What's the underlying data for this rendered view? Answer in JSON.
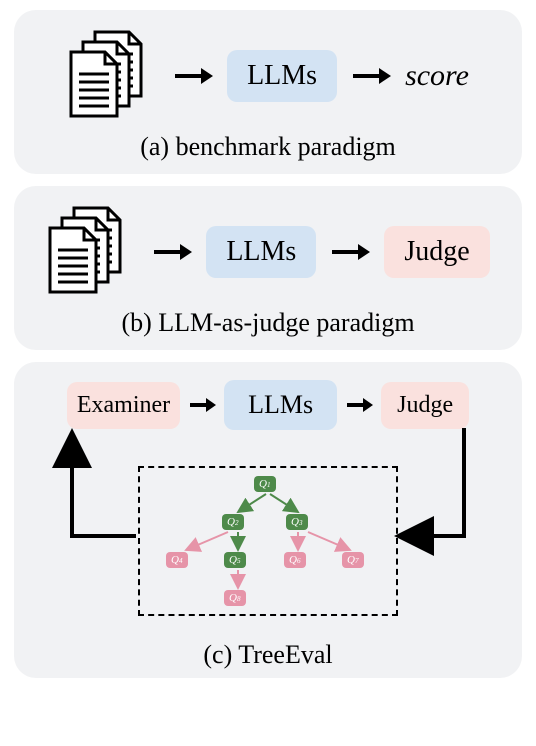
{
  "panels": {
    "a": {
      "caption": "(a) benchmark paradigm",
      "llm": "LLMs",
      "output": "score"
    },
    "b": {
      "caption": "(b) LLM-as-judge paradigm",
      "llm": "LLMs",
      "judge": "Judge"
    },
    "c": {
      "caption": "(c) TreeEval",
      "examiner": "Examiner",
      "llm": "LLMs",
      "judge": "Judge",
      "tree_nodes": [
        {
          "id": "Q1",
          "label": "Q₁",
          "role": "green"
        },
        {
          "id": "Q2",
          "label": "Q₂",
          "role": "green"
        },
        {
          "id": "Q3",
          "label": "Q₃",
          "role": "green"
        },
        {
          "id": "Q4",
          "label": "Q₄",
          "role": "pink"
        },
        {
          "id": "Q5",
          "label": "Q₅",
          "role": "green"
        },
        {
          "id": "Q6",
          "label": "Q₆",
          "role": "pink"
        },
        {
          "id": "Q7",
          "label": "Q₇",
          "role": "pink"
        },
        {
          "id": "Q8",
          "label": "Q₈",
          "role": "pink"
        }
      ]
    }
  },
  "colors": {
    "panel_bg": "#f1f2f4",
    "blue": "#d3e3f3",
    "pink": "#fae1de",
    "node_green": "#4e8a4a",
    "node_pink": "#e694a8"
  },
  "chart_data": {
    "type": "tree",
    "title": "TreeEval question tree",
    "nodes": [
      "Q1",
      "Q2",
      "Q3",
      "Q4",
      "Q5",
      "Q6",
      "Q7",
      "Q8"
    ],
    "edges": [
      [
        "Q1",
        "Q2"
      ],
      [
        "Q1",
        "Q3"
      ],
      [
        "Q2",
        "Q4"
      ],
      [
        "Q2",
        "Q5"
      ],
      [
        "Q3",
        "Q6"
      ],
      [
        "Q3",
        "Q7"
      ],
      [
        "Q5",
        "Q8"
      ]
    ],
    "node_states": {
      "green": [
        "Q1",
        "Q2",
        "Q3",
        "Q5"
      ],
      "pink": [
        "Q4",
        "Q6",
        "Q7",
        "Q8"
      ]
    }
  }
}
